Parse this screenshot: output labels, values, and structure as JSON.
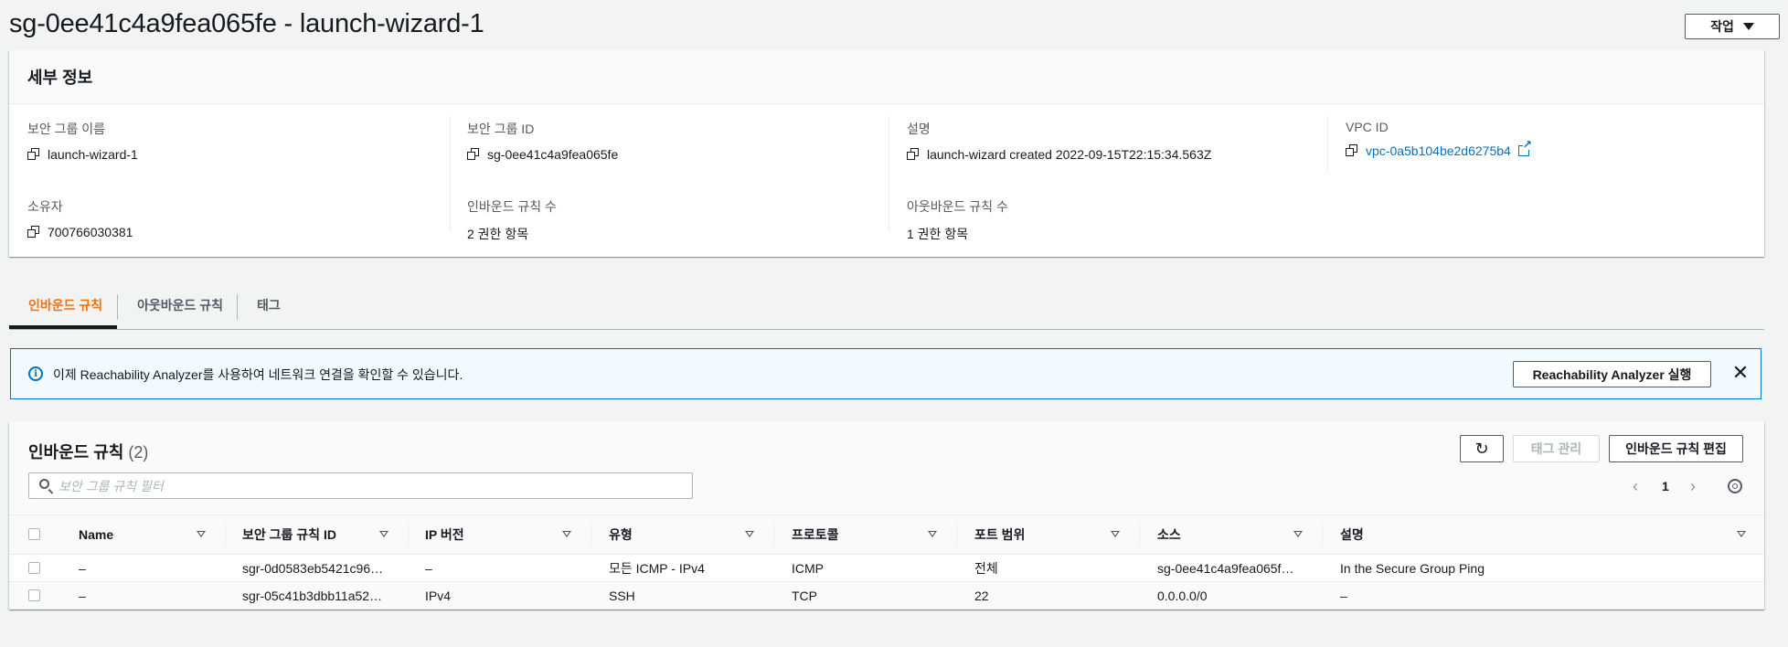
{
  "page": {
    "title": "sg-0ee41c4a9fea065fe - launch-wizard-1",
    "actions_label": "작업"
  },
  "details": {
    "header": "세부 정보",
    "fields": [
      {
        "label": "보안 그룹 이름",
        "value": "launch-wizard-1"
      },
      {
        "label": "보안 그룹 ID",
        "value": "sg-0ee41c4a9fea065fe"
      },
      {
        "label": "설명",
        "value": "launch-wizard created 2022-09-15T22:15:34.563Z"
      },
      {
        "label": "VPC ID",
        "value": "vpc-0a5b104be2d6275b4"
      },
      {
        "label": "소유자",
        "value": "700766030381"
      },
      {
        "label": "인바운드 규칙 수",
        "value": "2 권한 항목"
      },
      {
        "label": "아웃바운드 규칙 수",
        "value": "1 권한 항목"
      }
    ]
  },
  "tabs": [
    {
      "label": "인바운드 규칙",
      "active": true
    },
    {
      "label": "아웃바운드 규칙",
      "active": false
    },
    {
      "label": "태그",
      "active": false
    }
  ],
  "alert": {
    "text": "이제 Reachability Analyzer를 사용하여 네트워크 연결을 확인할 수 있습니다.",
    "button_label": "Reachability Analyzer 실행",
    "close_glyph": "✕"
  },
  "rules": {
    "title": "인바운드 규칙",
    "count": "(2)",
    "refresh_glyph": "↻",
    "tag_manage_label": "태그 관리",
    "edit_label": "인바운드 규칙 편집",
    "search_placeholder": "보안 그룹 규칙 필터",
    "page_number": "1",
    "prev_glyph": "‹",
    "next_glyph": "›",
    "columns": [
      "Name",
      "보안 그룹 규칙 ID",
      "IP 버전",
      "유형",
      "프로토콜",
      "포트 범위",
      "소스",
      "설명"
    ],
    "rows": [
      [
        "–",
        "sgr-0d0583eb5421c96…",
        "–",
        "모든 ICMP - IPv4",
        "ICMP",
        "전체",
        "sg-0ee41c4a9fea065f…",
        "In the Secure Group Ping"
      ],
      [
        "–",
        "sgr-05c41b3dbb11a52…",
        "IPv4",
        "SSH",
        "TCP",
        "22",
        "0.0.0.0/0",
        "–"
      ]
    ]
  },
  "colors": {
    "accent_orange": "#ec7211",
    "link_blue": "#0073bb",
    "text_dark": "#16191f",
    "text_muted": "#545b64"
  }
}
